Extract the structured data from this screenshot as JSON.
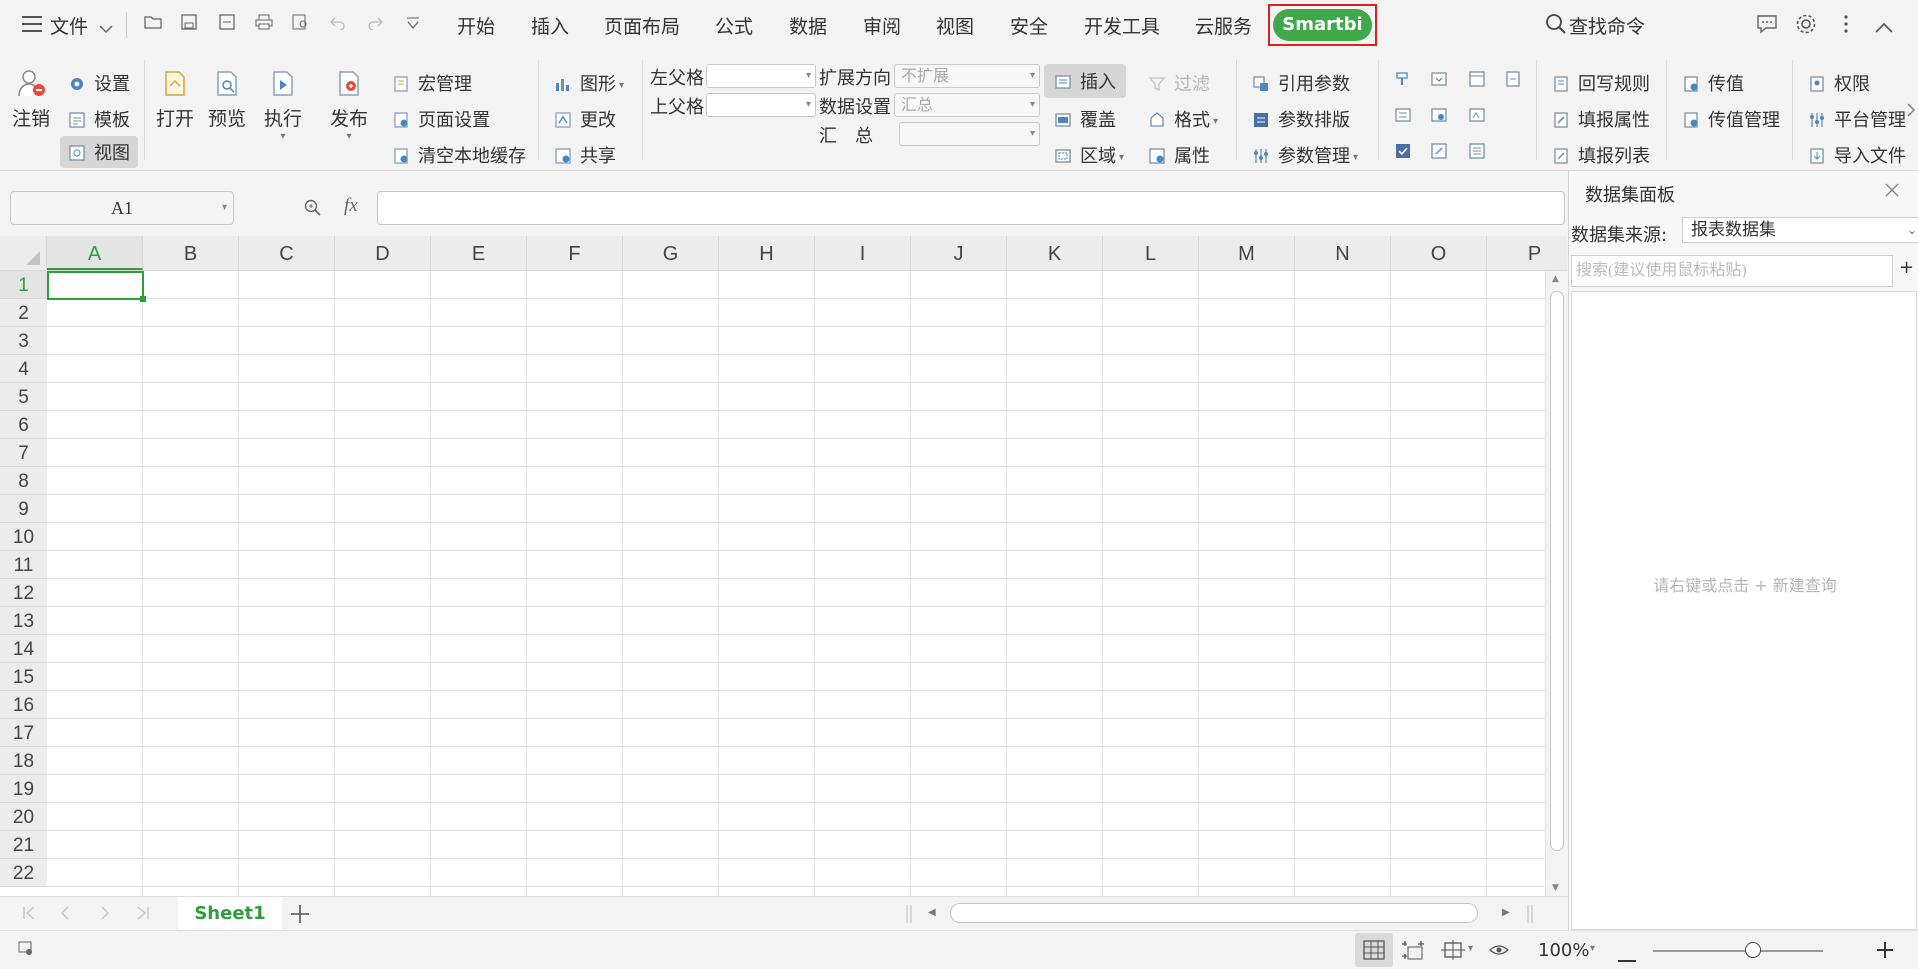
{
  "menubar": {
    "file_label": "文件",
    "tabs": [
      "开始",
      "插入",
      "页面布局",
      "公式",
      "数据",
      "审阅",
      "视图",
      "安全",
      "开发工具",
      "云服务"
    ],
    "active_tab": "Smartbi",
    "search_label": "查找命令"
  },
  "ribbon": {
    "logout": "注销",
    "settings": "设置",
    "template": "模板",
    "view": "视图",
    "open": "打开",
    "preview": "预览",
    "execute": "执行",
    "publish": "发布",
    "macro": "宏管理",
    "page_setup": "页面设置",
    "clear_cache": "清空本地缓存",
    "chart": "图形",
    "change": "更改",
    "share": "共享",
    "left_parent": "左父格",
    "top_parent": "上父格",
    "expand_dir": "扩展方向",
    "expand_value": "不扩展",
    "data_setting": "数据设置",
    "data_value": "汇总",
    "summary": "汇　总",
    "insert": "插入",
    "cover": "覆盖",
    "region": "区域",
    "filter": "过滤",
    "format": "格式",
    "property": "属性",
    "ref_param": "引用参数",
    "param_layout": "参数排版",
    "param_manage": "参数管理",
    "writeback": "回写规则",
    "fill_prop": "填报属性",
    "fill_list": "填报列表",
    "pass_value": "传值",
    "pass_manage": "传值管理",
    "permission": "权限",
    "platform": "平台管理",
    "import": "导入文件"
  },
  "formula_bar": {
    "cell_ref": "A1",
    "fx": "fx",
    "value": ""
  },
  "grid": {
    "columns": [
      "A",
      "B",
      "C",
      "D",
      "E",
      "F",
      "G",
      "H",
      "I",
      "J",
      "K",
      "L",
      "M",
      "N",
      "O",
      "P"
    ],
    "rows": [
      "1",
      "2",
      "3",
      "4",
      "5",
      "6",
      "7",
      "8",
      "9",
      "10",
      "11",
      "12",
      "13",
      "14",
      "15",
      "16",
      "17",
      "18",
      "19",
      "20",
      "21",
      "22"
    ],
    "active_cell": "A1"
  },
  "sheets": {
    "active": "Sheet1"
  },
  "status": {
    "zoom": "100%"
  },
  "panel": {
    "title": "数据集面板",
    "source_label": "数据集来源:",
    "source_value": "报表数据集",
    "search_placeholder": "搜索(建议使用鼠标粘贴)",
    "add": "+",
    "hint": "请右键或点击 + 新建查询"
  },
  "colors": {
    "accent": "#3ea84a",
    "highlight_border": "#e02020"
  }
}
